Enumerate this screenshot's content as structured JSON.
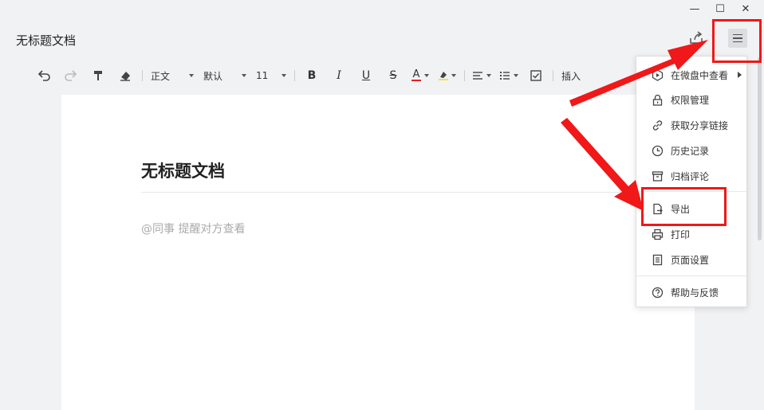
{
  "window": {
    "title": "无标题文档",
    "controls": {
      "minimize": "—",
      "maximize": "☐",
      "close": "✕"
    }
  },
  "toolbar": {
    "style_label": "正文",
    "font_label": "默认",
    "size_label": "11",
    "bold": "B",
    "italic": "I",
    "underline": "U",
    "strike": "S",
    "font_color": "A",
    "insert_label": "插入",
    "font_color_hex": "#e02020",
    "highlight_hex": "#f5e23a"
  },
  "document": {
    "heading": "无标题文档",
    "mention_hint": "@同事 提醒对方查看"
  },
  "menu": {
    "items": [
      {
        "label": "在微盘中查看",
        "icon": "weipan-icon",
        "submenu": true
      },
      {
        "label": "权限管理",
        "icon": "lock-icon"
      },
      {
        "label": "获取分享链接",
        "icon": "link-icon"
      },
      {
        "label": "历史记录",
        "icon": "clock-icon"
      },
      {
        "label": "归档评论",
        "icon": "archive-icon"
      },
      {
        "label": "导出",
        "icon": "export-icon"
      },
      {
        "label": "打印",
        "icon": "printer-icon"
      },
      {
        "label": "页面设置",
        "icon": "page-settings-icon"
      },
      {
        "label": "帮助与反馈",
        "icon": "help-icon"
      }
    ]
  },
  "annotation": {
    "highlight_color": "#f01818"
  }
}
